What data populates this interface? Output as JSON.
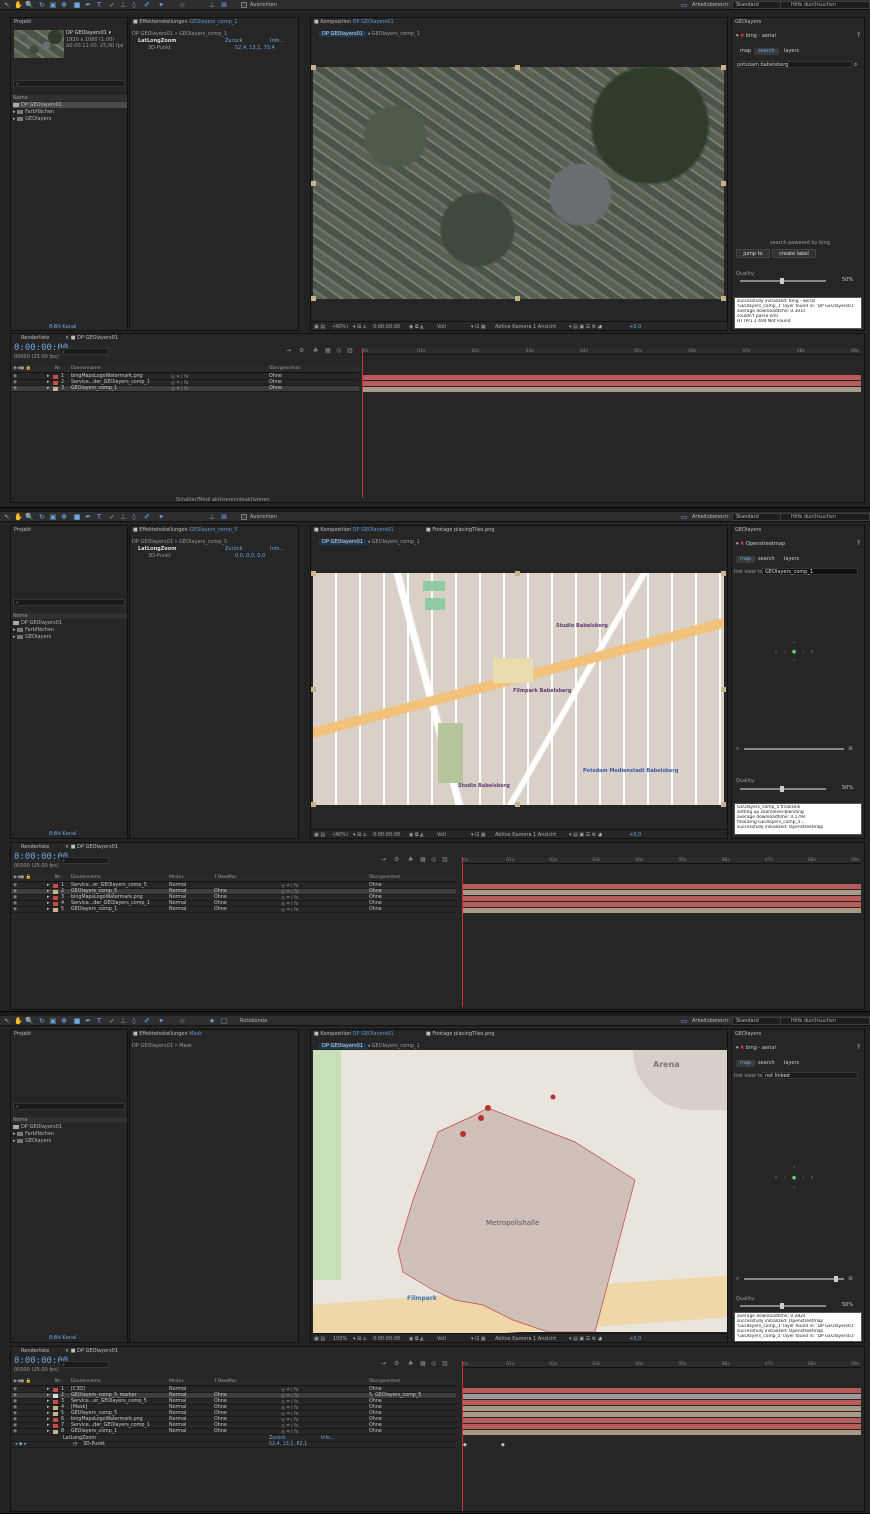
{
  "toolbar": {
    "align_label": "Ausrichten",
    "workspace_label": "Arbeitsbereich:",
    "workspace_value": "Standard",
    "help_search_placeholder": "Hilfe durchsuchen",
    "rotobrush_label": "Rotobürste"
  },
  "shots": [
    {
      "project": {
        "tab": "Projekt",
        "comp_name": "DP GEOlayers01 ▾",
        "comp_res": "1920 x 1080 (1,00)",
        "comp_dur": "Δ0:00:11:00, 25,00 fps",
        "col_name": "Name",
        "items": [
          "DP GEOlayers01",
          "Farbflächen",
          "GEOlayers"
        ],
        "bpc": "8-Bit-Kanal"
      },
      "effects": {
        "tab": "Effekteinstellungen",
        "tab_target": "GEOlayers_comp_1",
        "path": "DP GEOlayers01 • GEOlayers_comp_1",
        "effect": "LatLongZoom",
        "reset": "Zurück",
        "info": "Info...",
        "param": "3D-Punkt",
        "value": "52,4, 13,1, 73,4"
      },
      "comp": {
        "tab": "Komposition",
        "tab_target": "DP GEOlayers01",
        "crumbs": [
          "DP GEOlayers01",
          "GEOlayers_comp_1"
        ],
        "zoom": "(40%)",
        "time": "0:00:00:00",
        "res": "Voll",
        "camera": "Aktive Kamera",
        "views": "1 Ansicht",
        "exposure": "+0,0"
      },
      "geo": {
        "tab": "GEOlayers",
        "provider": "bing - aerial",
        "tabs": [
          "map",
          "search",
          "layers"
        ],
        "active_tab": "search",
        "query": "potsdam babelsberg",
        "powered": "search powered by bing",
        "jump": "jump to",
        "create": "create label",
        "quality": "Quality:",
        "quality_val": "50%",
        "log": [
          "successfully initialized: bing - aerial",
          "'GEOlayers_comp_1' layer found in: 'DP GEOlayers01'",
          "average downloadtime: 0.301s",
          "couldn't parse xml",
          "HTTP/1.1 404 Not Found"
        ]
      },
      "timeline": {
        "render_tab": "Renderliste",
        "comp_tab": "DP GEOlayers01",
        "timecode": "0:00:00:00",
        "fps": "00000 (25.00 fps)",
        "col_nr": "Nr.",
        "col_name": "Ebenenname",
        "col_parent": "Übergeordnet",
        "layers": [
          {
            "nr": "1",
            "name": "bingMapsLogoWatermark.png",
            "color": "#c94a4a",
            "parent": "Ohne"
          },
          {
            "nr": "2",
            "name": "Service...der_GEOlayers_comp_1",
            "color": "#c94a4a",
            "parent": "Ohne"
          },
          {
            "nr": "3",
            "name": "GEOlayers_comp_1",
            "color": "#c8b38d",
            "parent": "Ohne"
          }
        ],
        "ruler": [
          "0s",
          "01s",
          "02s",
          "03s",
          "04s",
          "05s",
          "06s",
          "07s",
          "08s",
          "09s"
        ],
        "footer": "Schalter/Modi aktivieren/deaktivieren"
      }
    },
    {
      "project": {
        "tab": "Projekt",
        "col_name": "Name",
        "items": [
          "DP GEOlayers01",
          "Farbflächen",
          "GEOlayers"
        ],
        "bpc": "8-Bit-Kanal"
      },
      "effects": {
        "tab": "Effekteinstellungen",
        "tab_target": "GEOlayers_comp_5",
        "path": "DP GEOlayers01 • GEOlayers_comp_5",
        "effect": "LatLongZoom",
        "reset": "Zurück",
        "info": "Info...",
        "param": "3D-Punkt",
        "value": "0,0, 0,0, 0,0"
      },
      "comp": {
        "tab": "Komposition",
        "tab_target": "DP GEOlayers01",
        "tab2": "Footage placingTiles.png",
        "crumbs": [
          "DP GEOlayers01",
          "GEOlayers_comp_1"
        ],
        "zoom": "(40%)",
        "time": "0:00:00:00",
        "res": "Voll",
        "camera": "Aktive Kamera",
        "views": "1 Ansicht",
        "exposure": "+0,0",
        "map_labels": [
          "Studio Babelsberg",
          "Filmpark Babelsberg",
          "Studio Babelsberg",
          "Potsdam Medienstadt Babelsberg"
        ]
      },
      "geo": {
        "tab": "GEOlayers",
        "provider": "Openstreetmap",
        "tabs": [
          "map",
          "search",
          "layers"
        ],
        "active_tab": "map",
        "link_label": "link view to:",
        "link_value": "GEOlayers_comp_1",
        "quality": "Quality:",
        "quality_val": "50%",
        "log": [
          "GEOlayers_comp_5 finalizedi",
          "setting up zoomlevel-blending",
          "average downloadtime: 0.179s",
          "finalizing GEOlayers_comp_5...",
          "successfully initialized: Openstreetmap"
        ]
      },
      "timeline": {
        "render_tab": "Renderliste",
        "comp_tab": "DP GEOlayers01",
        "timecode": "0:00:00:00",
        "fps": "00000 (25.00 fps)",
        "col_nr": "Nr.",
        "col_name": "Ebenenname",
        "col_mode": "Modus",
        "col_trkmat": "T BewMas",
        "col_parent": "Übergeordnet",
        "layers": [
          {
            "nr": "1",
            "name": "Service...er_GEOlayers_comp_5",
            "color": "#c94a4a",
            "mode": "Normal",
            "trk": "",
            "parent": "Ohne"
          },
          {
            "nr": "2",
            "name": "GEOlayers_comp_5",
            "color": "#c8b38d",
            "mode": "Normal",
            "trk": "Ohne",
            "parent": "Ohne"
          },
          {
            "nr": "3",
            "name": "bingMapsLogoWatermark.png",
            "color": "#c94a4a",
            "mode": "Normal",
            "trk": "Ohne",
            "parent": "Ohne"
          },
          {
            "nr": "4",
            "name": "Service...der_GEOlayers_comp_1",
            "color": "#c94a4a",
            "mode": "Normal",
            "trk": "Ohne",
            "parent": "Ohne"
          },
          {
            "nr": "5",
            "name": "GEOlayers_comp_1",
            "color": "#c8b38d",
            "mode": "Normal",
            "trk": "Ohne",
            "parent": "Ohne"
          }
        ],
        "ruler": [
          "0s",
          "01s",
          "02s",
          "03s",
          "04s",
          "05s",
          "06s",
          "07s",
          "08s",
          "09s"
        ]
      }
    },
    {
      "project": {
        "tab": "Projekt",
        "col_name": "Name",
        "items": [
          "DP GEOlayers01",
          "Farbflächen",
          "GEOlayers"
        ],
        "bpc": "8-Bit-Kanal"
      },
      "effects": {
        "tab": "Effekteinstellungen",
        "tab_target": "Mask",
        "path": "DP GEOlayers01 • Mask"
      },
      "comp": {
        "tab": "Komposition",
        "tab_target": "DP GEOlayers01",
        "tab2": "Footage placingTiles.png",
        "crumbs": [
          "DP GEOlayers01",
          "GEOlayers_comp_1"
        ],
        "zoom": "100%",
        "time": "0:00:00:00",
        "res": "Voll",
        "camera": "Aktive Kamera",
        "views": "1 Ansicht",
        "exposure": "+0,0",
        "map_labels": [
          "Arena",
          "Metropolishalle",
          "Filmpark"
        ]
      },
      "geo": {
        "tab": "GEOlayers",
        "provider": "bing - aerial",
        "tabs": [
          "map",
          "search",
          "layers"
        ],
        "active_tab": "map",
        "link_label": "link view to:",
        "link_value": "not linked",
        "quality": "Quality:",
        "quality_val": "50%",
        "log": [
          "average downloadtime: 0.282s",
          "successfully initialized: Openstreetmap",
          "'GEOlayers_comp_1' layer found in: 'DP GEOlayers01'",
          "successfully initialized: Openstreetmap",
          "'GEOlayers_comp_5' layer found in: 'DP GEOlayers01'"
        ]
      },
      "timeline": {
        "render_tab": "Renderliste",
        "comp_tab": "DP GEOlayers01",
        "timecode": "0:00:00:00",
        "fps": "00000 (25.00 fps)",
        "col_nr": "Nr.",
        "col_name": "Ebenenname",
        "col_mode": "Modus",
        "col_trkmat": "T BewMas",
        "col_parent": "Übergeordnet",
        "layers": [
          {
            "nr": "1",
            "name": "[C3D]",
            "color": "#c94a4a",
            "mode": "Normal",
            "trk": "",
            "parent": "Ohne"
          },
          {
            "nr": "2",
            "name": "GEOlayers_comp_5_marker",
            "color": "#dddddd",
            "mode": "Normal",
            "trk": "Ohne",
            "parent": "5. GEOlayers_comp_5"
          },
          {
            "nr": "3",
            "name": "Service...er_GEOlayers_comp_5",
            "color": "#c94a4a",
            "mode": "Normal",
            "trk": "Ohne",
            "parent": "Ohne"
          },
          {
            "nr": "4",
            "name": "[Mask]",
            "color": "#c8b38d",
            "mode": "Normal",
            "trk": "Ohne",
            "parent": "Ohne"
          },
          {
            "nr": "5",
            "name": "GEOlayers_comp_5",
            "color": "#c8b38d",
            "mode": "Normal",
            "trk": "Ohne",
            "parent": "Ohne"
          },
          {
            "nr": "6",
            "name": "bingMapsLogoWatermark.png",
            "color": "#c94a4a",
            "mode": "Normal",
            "trk": "Ohne",
            "parent": "Ohne"
          },
          {
            "nr": "7",
            "name": "Service...der_GEOlayers_comp_1",
            "color": "#c94a4a",
            "mode": "Normal",
            "trk": "Ohne",
            "parent": "Ohne"
          },
          {
            "nr": "8",
            "name": "GEOlayers_comp_1",
            "color": "#c8b38d",
            "mode": "Normal",
            "trk": "Ohne",
            "parent": "Ohne"
          }
        ],
        "sub_effect": "LatLongZoom",
        "sub_param": "3D-Punkt",
        "sub_reset": "Zurück",
        "sub_info": "Info...",
        "sub_value": "52,4, 13,1, 82,1",
        "ruler": [
          "0s",
          "01s",
          "02s",
          "03s",
          "04s",
          "05s",
          "06s",
          "07s",
          "08s",
          "09s"
        ]
      }
    }
  ],
  "colors": {
    "accent": "#6fa6e0",
    "cti": "#d03030",
    "label_red": "#c94a4a",
    "label_sand": "#c8b38d"
  }
}
